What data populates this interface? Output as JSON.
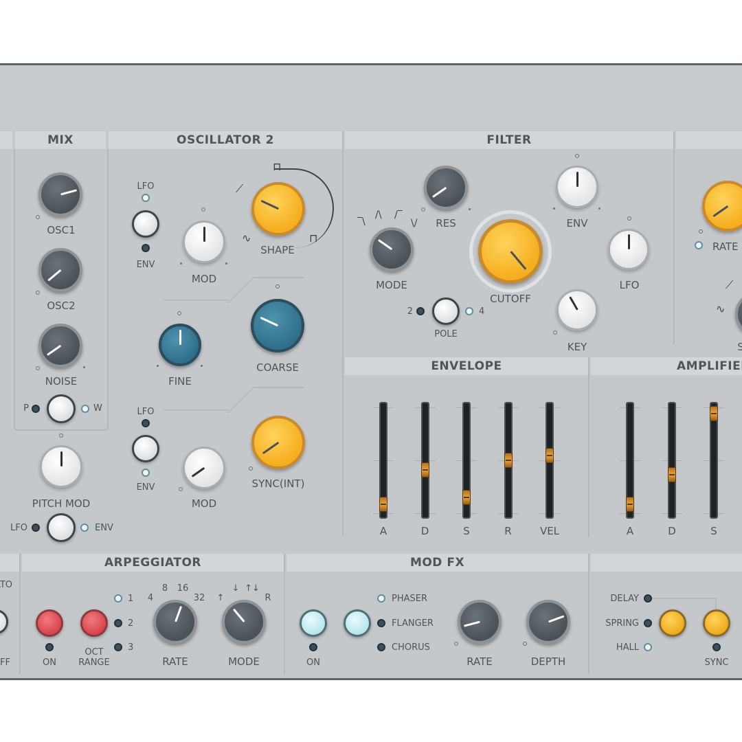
{
  "sections": {
    "mix": "MIX",
    "oscillator2": "OSCILLATOR 2",
    "filter": "FILTER",
    "envelope": "ENVELOPE",
    "amplifier": "AMPLIFIER",
    "arpeggiator": "ARPEGGIATOR",
    "modfx": "MOD FX"
  },
  "mix": {
    "osc1": "OSC1",
    "osc2": "OSC2",
    "noise": "NOISE",
    "p": "P",
    "w": "W",
    "pitch_mod": "PITCH MOD",
    "lfo": "LFO",
    "env": "ENV"
  },
  "osc2": {
    "lfo_top": "LFO",
    "env_top": "ENV",
    "mod_top": "MOD",
    "shape": "SHAPE",
    "fine": "FINE",
    "coarse": "COARSE",
    "lfo_bottom": "LFO",
    "env_bottom": "ENV",
    "mod_bottom": "MOD",
    "sync": "SYNC(INT)"
  },
  "filter": {
    "res": "RES",
    "mode": "MODE",
    "cutoff": "CUTOFF",
    "env": "ENV",
    "lfo": "LFO",
    "key": "KEY",
    "pole": "POLE",
    "pole_2": "2",
    "pole_4": "4"
  },
  "lfo_partial": {
    "rate": "RATE",
    "s": "S"
  },
  "envelope": {
    "sliders": [
      {
        "label": "A",
        "value": 0.05
      },
      {
        "label": "D",
        "value": 0.4
      },
      {
        "label": "S",
        "value": 0.12
      },
      {
        "label": "R",
        "value": 0.5
      },
      {
        "label": "VEL",
        "value": 0.55
      }
    ]
  },
  "amplifier": {
    "sliders": [
      {
        "label": "A",
        "value": 0.05
      },
      {
        "label": "D",
        "value": 0.35
      },
      {
        "label": "S",
        "value": 0.98
      }
    ]
  },
  "glide_partial": {
    "ato": "ATO",
    "ff": "FF"
  },
  "arpeggiator": {
    "on": "ON",
    "oct_range_1": "OCT",
    "oct_range_2": "RANGE",
    "oct_1": "1",
    "oct_2": "2",
    "oct_3": "3",
    "rate": "RATE",
    "rate_4": "4",
    "rate_8": "8",
    "rate_16": "16",
    "rate_32": "32",
    "mode": "MODE",
    "mode_up": "↑",
    "mode_down": "↓",
    "mode_updown": "↑↓",
    "mode_r": "R"
  },
  "modfx": {
    "on": "ON",
    "phaser": "PHASER",
    "flanger": "FLANGER",
    "chorus": "CHORUS",
    "rate": "RATE",
    "depth": "DEPTH"
  },
  "delay_partial": {
    "delay": "DELAY",
    "spring": "SPRING",
    "hall": "HALL",
    "sync": "SYNC"
  },
  "colors": {
    "panel": "#c5c8cb",
    "knob_yellow": "#f5ae1f",
    "knob_blue": "#2f6f89",
    "button_red": "#d8454d",
    "button_cyan": "#b6e6ec"
  }
}
